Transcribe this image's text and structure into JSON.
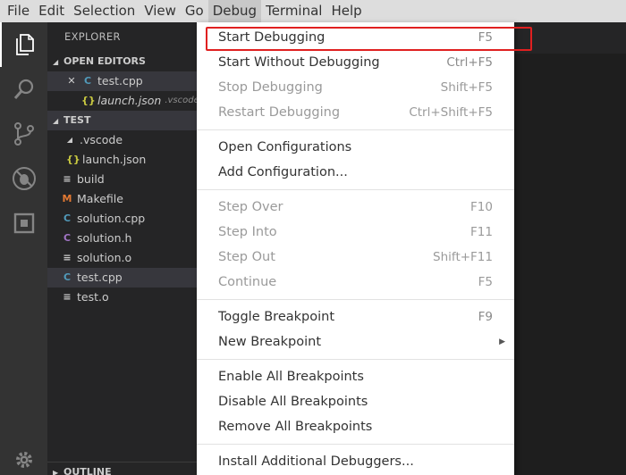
{
  "menubar": {
    "items": [
      "File",
      "Edit",
      "Selection",
      "View",
      "Go",
      "Debug",
      "Terminal",
      "Help"
    ],
    "active": "Debug"
  },
  "activity": {
    "icons": [
      "files-icon",
      "search-icon",
      "source-control-icon",
      "debug-icon",
      "extensions-icon",
      "gear-icon"
    ]
  },
  "sidebar": {
    "title": "EXPLORER",
    "open_editors": {
      "header": "OPEN EDITORS",
      "items": [
        {
          "name": "test.cpp",
          "desc": ""
        },
        {
          "name": "launch.json",
          "desc": ".vscode"
        }
      ]
    },
    "workspace": {
      "header": "TEST",
      "items": [
        {
          "name": ".vscode",
          "icon": "folder-open-icon"
        },
        {
          "name": "launch.json",
          "icon": "json-file-icon"
        },
        {
          "name": "build",
          "icon": "file-icon"
        },
        {
          "name": "Makefile",
          "icon": "makefile-icon"
        },
        {
          "name": "solution.cpp",
          "icon": "cpp-file-icon"
        },
        {
          "name": "solution.h",
          "icon": "c-header-icon"
        },
        {
          "name": "solution.o",
          "icon": "file-icon"
        },
        {
          "name": "test.cpp",
          "icon": "cpp-file-icon"
        },
        {
          "name": "test.o",
          "icon": "file-icon"
        }
      ]
    },
    "outline_header": "OUTLINE"
  },
  "debug_menu": {
    "groups": [
      [
        {
          "label": "Start Debugging",
          "shortcut": "F5",
          "enabled": true
        },
        {
          "label": "Start Without Debugging",
          "shortcut": "Ctrl+F5",
          "enabled": true
        },
        {
          "label": "Stop Debugging",
          "shortcut": "Shift+F5",
          "enabled": false
        },
        {
          "label": "Restart Debugging",
          "shortcut": "Ctrl+Shift+F5",
          "enabled": false
        }
      ],
      [
        {
          "label": "Open Configurations",
          "shortcut": "",
          "enabled": true
        },
        {
          "label": "Add Configuration...",
          "shortcut": "",
          "enabled": true
        }
      ],
      [
        {
          "label": "Step Over",
          "shortcut": "F10",
          "enabled": false
        },
        {
          "label": "Step Into",
          "shortcut": "F11",
          "enabled": false
        },
        {
          "label": "Step Out",
          "shortcut": "Shift+F11",
          "enabled": false
        },
        {
          "label": "Continue",
          "shortcut": "F5",
          "enabled": false
        }
      ],
      [
        {
          "label": "Toggle Breakpoint",
          "shortcut": "F9",
          "enabled": true
        },
        {
          "label": "New Breakpoint",
          "shortcut": "",
          "enabled": true,
          "submenu": true
        }
      ],
      [
        {
          "label": "Enable All Breakpoints",
          "shortcut": "",
          "enabled": true
        },
        {
          "label": "Disable All Breakpoints",
          "shortcut": "",
          "enabled": true
        },
        {
          "label": "Remove All Breakpoints",
          "shortcut": "",
          "enabled": true
        }
      ],
      [
        {
          "label": "Install Additional Debuggers...",
          "shortcut": "",
          "enabled": true
        }
      ]
    ]
  },
  "colors": {
    "highlight_box": "#e02020",
    "cpp_icon": "#519aba",
    "c_icon": "#a074c4",
    "json_icon": "#cbcb41",
    "makefile_icon": "#e37933"
  }
}
